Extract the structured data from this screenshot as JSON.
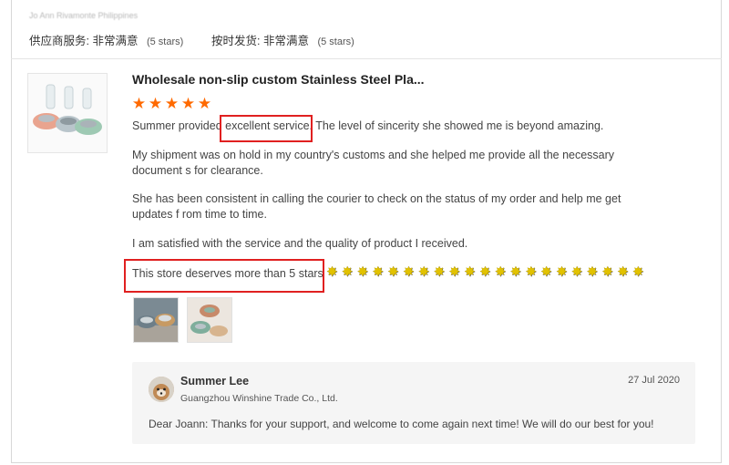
{
  "buyer": {
    "name": "Jo Ann Rivamonte Philippines"
  },
  "ratings": {
    "supplier_service": {
      "label": "供应商服务:",
      "value": "非常满意",
      "count": "(5 stars)"
    },
    "on_time_shipping": {
      "label": "按时发货:",
      "value": "非常满意",
      "count": "(5 stars)"
    }
  },
  "review": {
    "product_title": "Wholesale non-slip custom Stainless Steel Pla...",
    "star_rating": 5,
    "star_rating_max": 5,
    "paragraphs": [
      "Summer provided excellent service. The level of sincerity she showed me is beyond amazing.",
      "My shipment was on hold in my country's customs and she helped me provide all the necessary document s for clearance.",
      "She has been consistent in calling the courier to check on the status of my order and help me get updates f rom time to time.",
      "I am satisfied with the service and the quality of product I received.",
      "This store deserves more than 5 stars"
    ],
    "emoji_star_count": 21,
    "photos": [
      "review-photo-1",
      "review-photo-2"
    ]
  },
  "reply": {
    "name": "Summer Lee",
    "company": "Guangzhou Winshine Trade Co., Ltd.",
    "date": "27 Jul 2020",
    "text": "Dear Joann: Thanks for your support, and welcome to come again next time! We will do our best for you!"
  },
  "colors": {
    "star": "#ff6a00",
    "highlight": "#e02020",
    "reply_bg": "#f5f5f5"
  }
}
